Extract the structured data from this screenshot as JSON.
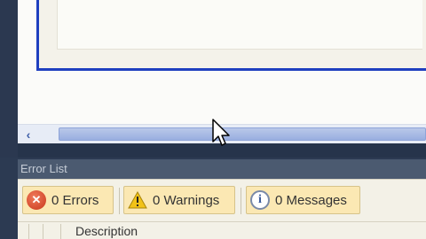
{
  "editor": {
    "scroll_left_icon": "chevron-left-icon"
  },
  "error_list": {
    "title": "Error List",
    "errors": {
      "icon": "error-icon",
      "label": "0 Errors"
    },
    "warnings": {
      "icon": "warning-icon",
      "label": "0 Warnings"
    },
    "messages": {
      "icon": "info-icon",
      "label": "0 Messages"
    },
    "columns": [
      "Description"
    ]
  },
  "colors": {
    "panel_bg": "#2c3a52",
    "design_border": "#1f3fbf",
    "filter_btn_bg": "#fbe8b3",
    "scroll_thumb": "#a8bbe4"
  },
  "cursor": {
    "icon": "mouse-pointer-icon"
  }
}
